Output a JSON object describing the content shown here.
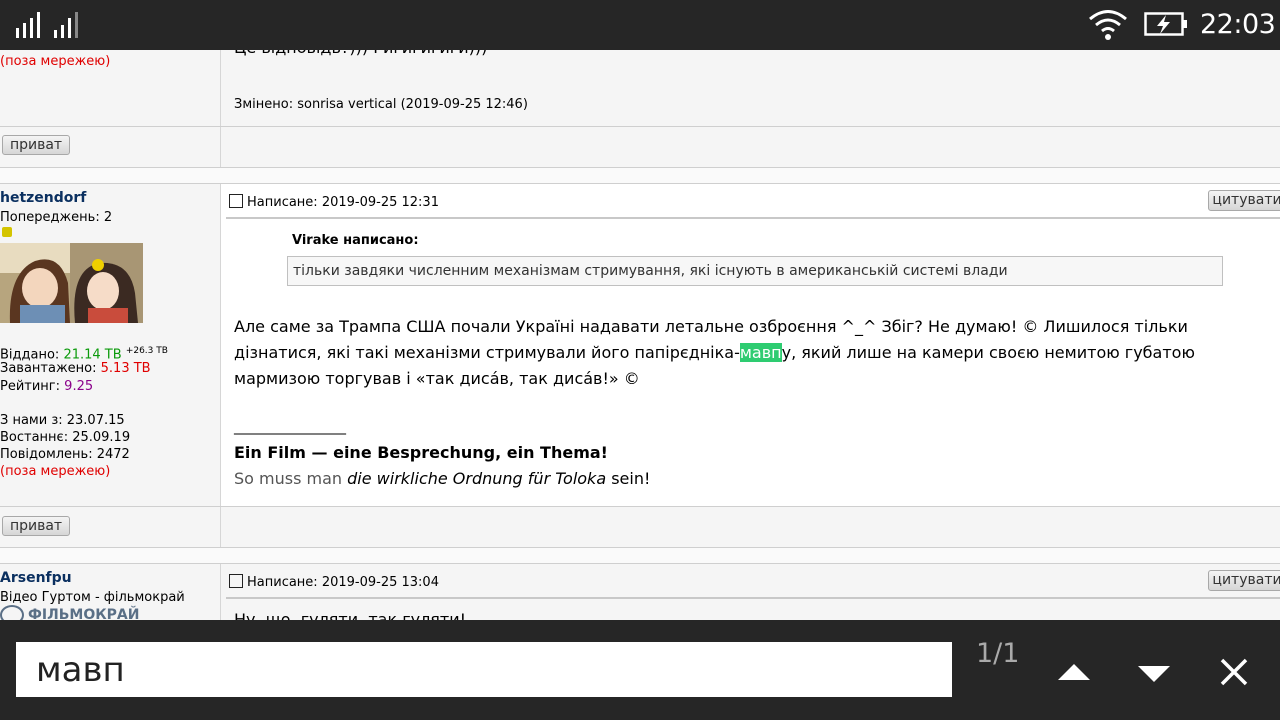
{
  "status": {
    "time": "22:03"
  },
  "post1": {
    "offline": "(поза мережею)",
    "text_tail": "Це відповідь?))) Гигигигиги)))",
    "edited": "Змінено: sonrisa vertical (2019-09-25 12:46)",
    "pm_label": "приват"
  },
  "post2": {
    "username": "hetzendorf",
    "warnings": "Попереджень: 2",
    "given_label": "Віддано:",
    "given_value": "21.14 TB",
    "given_delta": "+26.3 TB",
    "downloaded_label": "Завантажено:",
    "downloaded_value": "5.13 TB",
    "rating_label": "Рейтинг:",
    "rating_value": "9.25",
    "joined": "З нами з: 23.07.15",
    "last_seen": "Востаннє: 25.09.19",
    "messages": "Повідомлень: 2472",
    "offline": "(поза мережею)",
    "posted": "Написане: 2019-09-25 12:31",
    "quote_button": "цитувати",
    "quote_author": "Virake написано:",
    "quote_text": "тільки завдяки численним механізмам стримування, які існують в американській системі влади",
    "body_before": "Але саме за Трампа США почали Україні надавати летальне озброєння ^_^ Збіг? Не думаю! © Лишилося тільки дізнатися, які такі механізми стримували його папірєдніка-",
    "body_match": "мавп",
    "body_after": "у, який лише на камери своєю немитою губатою мармизою торгував і «так дисáв, так дисáв!» ©",
    "sig_line": "________________",
    "sig_title": "Ein Film — eine Besprechung, ein Thema!",
    "sig_text1": "So muss man",
    "sig_text2": "die wirkliche Ordnung für Toloka",
    "sig_text3": "sein!",
    "pm_label": "приват"
  },
  "post3": {
    "username": "Arsenfpu",
    "group": "Відео Гуртом - фільмокрай",
    "logo_text": "ФІЛЬМОКРАЙ",
    "posted": "Написане: 2019-09-25 13:04",
    "quote_button": "цитувати",
    "text_start": "Ну, що, гуляти, так гуляти!"
  },
  "find": {
    "query": "мавп",
    "count": "1/1"
  },
  "colors": {
    "highlight": "#2ecc71",
    "bar": "#262626",
    "username": "#0b3060"
  }
}
